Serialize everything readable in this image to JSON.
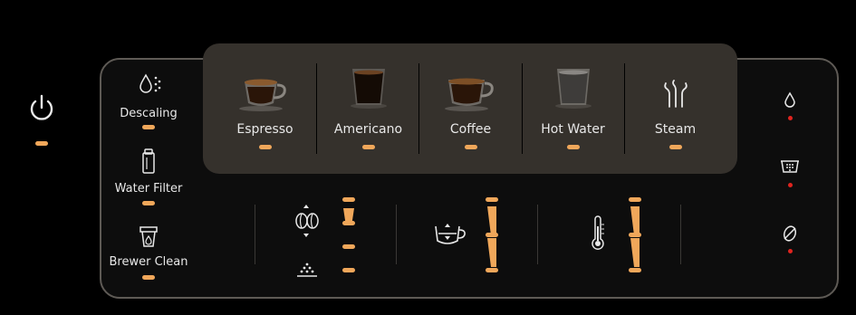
{
  "power": {
    "icon": "power-icon"
  },
  "maintenance": [
    {
      "label": "Descaling",
      "icon": "descaling-icon"
    },
    {
      "label": "Water Filter",
      "icon": "water-filter-icon"
    },
    {
      "label": "Brewer Clean",
      "icon": "brewer-clean-icon"
    }
  ],
  "beverages": [
    {
      "label": "Espresso",
      "icon": "espresso-cup-icon"
    },
    {
      "label": "Americano",
      "icon": "americano-cup-icon"
    },
    {
      "label": "Coffee",
      "icon": "coffee-cup-icon"
    },
    {
      "label": "Hot Water",
      "icon": "hot-water-cup-icon"
    },
    {
      "label": "Steam",
      "icon": "steam-icon"
    }
  ],
  "settings": [
    {
      "name": "aroma-strength",
      "icon": "bean-strength-icon",
      "levels": 4
    },
    {
      "name": "cup-volume",
      "icon": "cup-volume-icon",
      "levels": 3
    },
    {
      "name": "temperature",
      "icon": "thermometer-icon",
      "levels": 3
    }
  ],
  "status_indicators": [
    {
      "icon": "water-drop-icon"
    },
    {
      "icon": "grounds-container-icon"
    },
    {
      "icon": "no-beans-icon"
    }
  ],
  "colors": {
    "led": "#f0a75a",
    "alert": "#e0241f",
    "panel_border": "#5e5a55",
    "bev_panel": "#35312c"
  }
}
